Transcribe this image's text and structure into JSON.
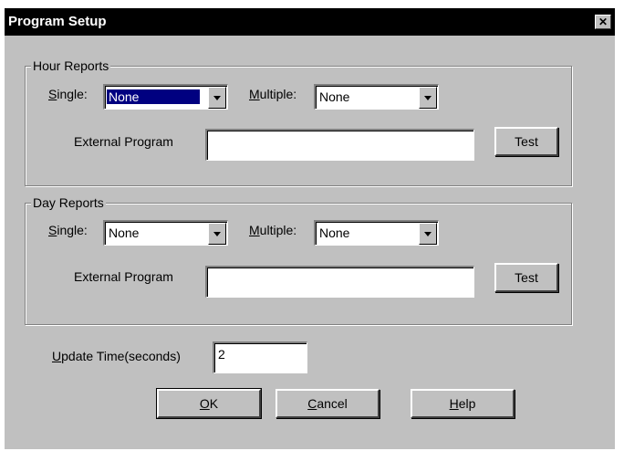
{
  "dialog": {
    "title": "Program Setup",
    "close_symbol": "✕",
    "hour_reports": {
      "label": "Hour Reports",
      "single_label_accel": "S",
      "single_label_rest": "ingle:",
      "single_value": "None",
      "multiple_label_accel": "M",
      "multiple_label_rest": "ultiple:",
      "multiple_value": "None",
      "external_label": "External Program",
      "external_value": "",
      "test_label": "Test"
    },
    "day_reports": {
      "label": "Day Reports",
      "single_label_accel": "S",
      "single_label_rest": "ingle:",
      "single_value": "None",
      "multiple_label_accel": "M",
      "multiple_label_rest": "ultiple:",
      "multiple_value": "None",
      "external_label": "External Program",
      "external_value": "",
      "test_label": "Test"
    },
    "update_time": {
      "label_accel": "U",
      "label_rest": "pdate Time(seconds)",
      "value": "2"
    },
    "buttons": {
      "ok_accel": "O",
      "ok_rest": "K",
      "cancel_accel": "C",
      "cancel_rest": "ancel",
      "help_accel": "H",
      "help_rest": "elp"
    }
  }
}
